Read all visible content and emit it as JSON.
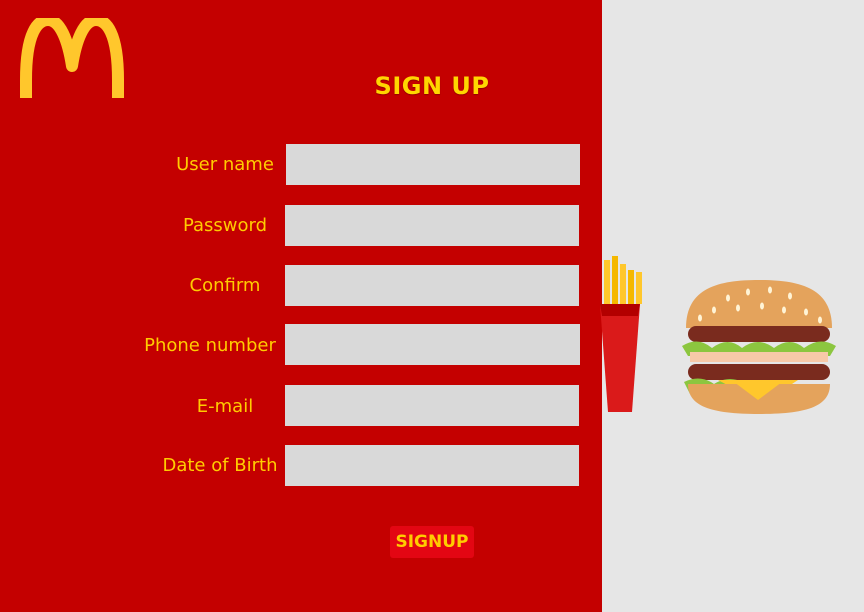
{
  "form": {
    "title": "SIGN UP",
    "fields": [
      {
        "label": "User name",
        "value": "",
        "placeholder": ""
      },
      {
        "label": "Password",
        "value": "",
        "placeholder": ""
      },
      {
        "label": "Confirm",
        "value": "",
        "placeholder": ""
      },
      {
        "label": "Phone number",
        "value": "",
        "placeholder": ""
      },
      {
        "label": "E-mail",
        "value": "",
        "placeholder": ""
      },
      {
        "label": "Date of Birth",
        "value": "",
        "placeholder": ""
      }
    ],
    "submit_label": "SIGNUP"
  },
  "icons": {
    "logo": "golden-arches-logo",
    "fries": "fries-icon",
    "burger": "burger-icon"
  },
  "colors": {
    "panel_background": "#c40000",
    "page_background": "#e6e6e6",
    "accent_yellow": "#ffcc00",
    "title_yellow": "#ffd600",
    "input_background": "#d9d9d9",
    "button_background": "#e30613"
  }
}
